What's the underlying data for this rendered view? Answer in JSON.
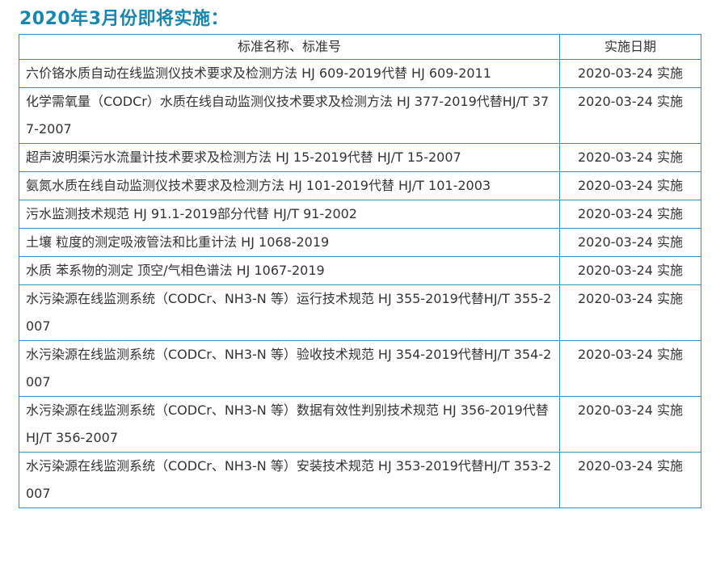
{
  "heading": "2020年3月份即将实施：",
  "table": {
    "headers": [
      "标准名称、标准号",
      "实施日期"
    ],
    "rows": [
      {
        "name": "六价铬水质自动在线监测仪技术要求及检测方法 HJ 609-2019代替 HJ 609-2011",
        "date": "2020-03-24 实施"
      },
      {
        "name": "化学需氧量（CODCr）水质在线自动监测仪技术要求及检测方法 HJ 377-2019代替HJ/T 377-2007",
        "date": "2020-03-24 实施"
      },
      {
        "name": "超声波明渠污水流量计技术要求及检测方法 HJ 15-2019代替 HJ/T 15-2007",
        "date": "2020-03-24 实施"
      },
      {
        "name": "氨氮水质在线自动监测仪技术要求及检测方法 HJ 101-2019代替 HJ/T 101-2003",
        "date": "2020-03-24 实施"
      },
      {
        "name": "污水监测技术规范 HJ 91.1-2019部分代替 HJ/T 91-2002",
        "date": "2020-03-24 实施"
      },
      {
        "name": "土壤 粒度的测定吸液管法和比重计法 HJ 1068-2019",
        "date": "2020-03-24 实施"
      },
      {
        "name": "水质 苯系物的测定 顶空/气相色谱法 HJ 1067-2019",
        "date": "2020-03-24 实施"
      },
      {
        "name": "水污染源在线监测系统（CODCr、NH3-N 等）运行技术规范 HJ 355-2019代替HJ/T 355-2007",
        "date": "2020-03-24 实施"
      },
      {
        "name": "水污染源在线监测系统（CODCr、NH3-N 等）验收技术规范 HJ 354-2019代替HJ/T 354-2007",
        "date": "2020-03-24 实施"
      },
      {
        "name": "水污染源在线监测系统（CODCr、NH3-N 等）数据有效性判别技术规范 HJ 356-2019代替 HJ/T 356-2007",
        "date": "2020-03-24 实施"
      },
      {
        "name": "水污染源在线监测系统（CODCr、NH3-N 等）安装技术规范 HJ 353-2019代替HJ/T 353-2007",
        "date": "2020-03-24 实施"
      }
    ]
  },
  "colors": {
    "heading": "#1a86b0",
    "border": "#2b93b8",
    "text": "#333333"
  }
}
